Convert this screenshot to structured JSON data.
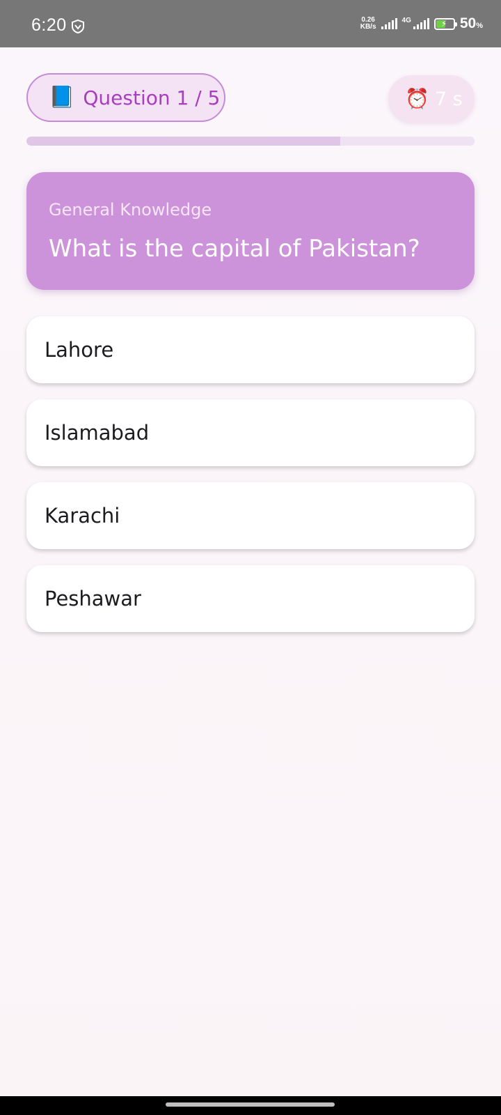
{
  "status_bar": {
    "time": "6:20",
    "net_speed_value": "0.26",
    "net_speed_unit": "KB/s",
    "network_type": "4G",
    "battery_level": "50",
    "battery_unit": "%",
    "icons": [
      "vpn-icon",
      "signal-icon",
      "signal-4g-icon",
      "battery-charging-icon"
    ]
  },
  "header": {
    "question_icon": "📘",
    "question_counter": "Question 1 / 5",
    "timer_icon": "⏰",
    "timer_value": "7 s"
  },
  "progress": {
    "fraction": 0.7
  },
  "question": {
    "category": "General Knowledge",
    "text": "What is the capital of Pakistan?"
  },
  "options": [
    {
      "label": "Lahore"
    },
    {
      "label": "Islamabad"
    },
    {
      "label": "Karachi"
    },
    {
      "label": "Peshawar"
    }
  ],
  "colors": {
    "accent": "#a93cc0",
    "card": "#cd93da",
    "pill_bg": "#f3e3f5",
    "progress_fill": "#dfc6e6",
    "progress_track": "#efe2f3",
    "battery_fill": "#6fd046"
  }
}
